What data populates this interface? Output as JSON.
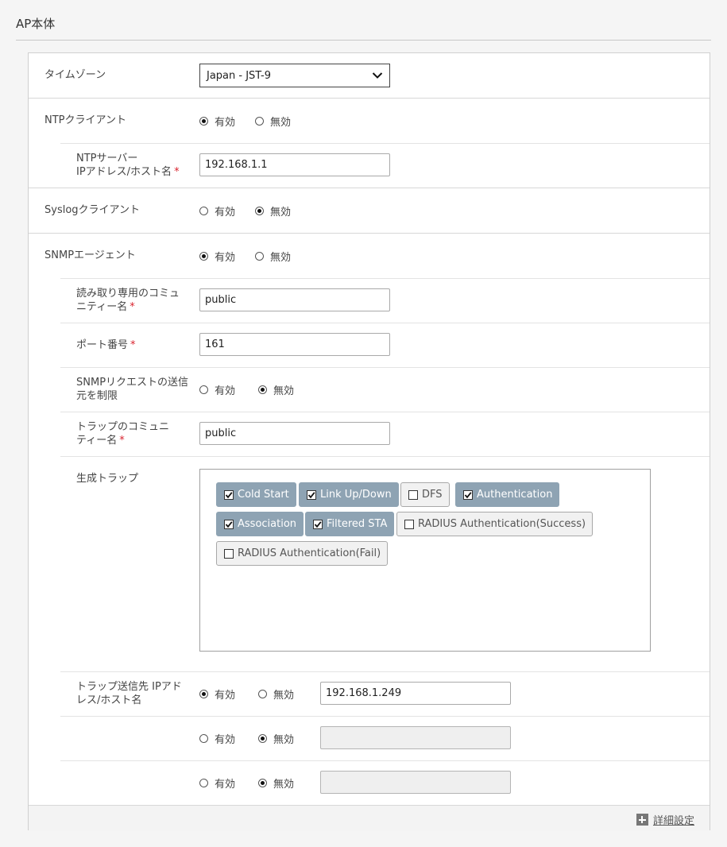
{
  "section": {
    "title": "AP本体"
  },
  "labels": {
    "enabled": "有効",
    "disabled": "無効"
  },
  "timezone": {
    "label": "タイムゾーン",
    "value": "Japan - JST-9"
  },
  "ntp_client": {
    "label": "NTPクライアント",
    "selected": "有効"
  },
  "ntp_server": {
    "label_line1": "NTPサーバー",
    "label_line2": "IPアドレス/ホスト名",
    "required_mark": "*",
    "value": "192.168.1.1"
  },
  "syslog_client": {
    "label": "Syslogクライアント",
    "selected": "無効"
  },
  "snmp_agent": {
    "label": "SNMPエージェント",
    "selected": "有効"
  },
  "ro_community": {
    "label_line1": "読み取り専用のコミュ",
    "label_line2": "ニティー名",
    "required_mark": "*",
    "value": "public"
  },
  "port": {
    "label": "ポート番号",
    "required_mark": "*",
    "value": "161"
  },
  "snmp_restrict": {
    "label_line1": "SNMPリクエストの送信",
    "label_line2": "元を制限",
    "selected": "無効"
  },
  "trap_community": {
    "label_line1": "トラップのコミュニ",
    "label_line2": "ティー名",
    "required_mark": "*",
    "value": "public"
  },
  "generated_traps": {
    "label": "生成トラップ",
    "items": [
      {
        "label": "Cold Start",
        "checked": true
      },
      {
        "label": "Link Up/Down",
        "checked": true
      },
      {
        "label": "DFS",
        "checked": false
      },
      {
        "label": "Authentication",
        "checked": true
      },
      {
        "label": "Association",
        "checked": true
      },
      {
        "label": "Filtered STA",
        "checked": true
      },
      {
        "label": "RADIUS Authentication(Success)",
        "checked": false
      },
      {
        "label": "RADIUS Authentication(Fail)",
        "checked": false
      }
    ]
  },
  "trap_destinations": {
    "label_line1": "トラップ送信先 IPアド",
    "label_line2": "レス/ホスト名",
    "rows": [
      {
        "selected": "有効",
        "value": "192.168.1.249"
      },
      {
        "selected": "無効",
        "value": ""
      },
      {
        "selected": "無効",
        "value": ""
      }
    ]
  },
  "footer": {
    "advanced_label": "詳細設定"
  },
  "colors": {
    "chip_checked_bg": "#8ea3b3",
    "required": "#d9232e"
  }
}
